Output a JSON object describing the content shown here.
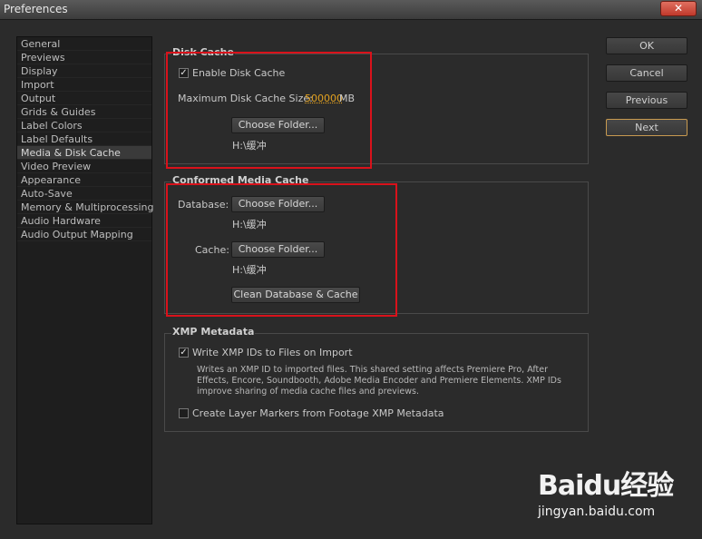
{
  "window": {
    "title": "Preferences",
    "close_label": "✕"
  },
  "sidebar": {
    "items": [
      {
        "label": "General"
      },
      {
        "label": "Previews"
      },
      {
        "label": "Display"
      },
      {
        "label": "Import"
      },
      {
        "label": "Output"
      },
      {
        "label": "Grids & Guides"
      },
      {
        "label": "Label Colors"
      },
      {
        "label": "Label Defaults"
      },
      {
        "label": "Media & Disk Cache",
        "selected": true
      },
      {
        "label": "Video Preview"
      },
      {
        "label": "Appearance"
      },
      {
        "label": "Auto-Save"
      },
      {
        "label": "Memory & Multiprocessing"
      },
      {
        "label": "Audio Hardware"
      },
      {
        "label": "Audio Output Mapping"
      }
    ]
  },
  "disk_cache": {
    "title": "Disk Cache",
    "enable_label": "Enable Disk Cache",
    "enable_checked": true,
    "max_size_label": "Maximum Disk Cache Size:",
    "max_size_value": "500000",
    "max_size_unit": "MB",
    "choose_folder_label": "Choose Folder...",
    "path": "H:\\缓冲"
  },
  "conformed_cache": {
    "title": "Conformed Media Cache",
    "database_label": "Database:",
    "database_button": "Choose Folder...",
    "database_path": "H:\\缓冲",
    "cache_label": "Cache:",
    "cache_button": "Choose Folder...",
    "cache_path": "H:\\缓冲",
    "clean_button": "Clean Database & Cache"
  },
  "xmp": {
    "title": "XMP Metadata",
    "write_ids_label": "Write XMP IDs to Files on Import",
    "write_ids_checked": true,
    "description": "Writes an XMP ID to imported files. This shared setting affects Premiere Pro, After Effects, Encore, Soundbooth, Adobe Media Encoder and Premiere Elements. XMP IDs improve sharing of media cache files and previews.",
    "layer_markers_label": "Create Layer Markers from Footage XMP Metadata",
    "layer_markers_checked": false
  },
  "buttons": {
    "ok": "OK",
    "cancel": "Cancel",
    "previous": "Previous",
    "next": "Next"
  },
  "watermark": {
    "logo": "Baidu经验",
    "url": "jingyan.baidu.com"
  },
  "colors": {
    "annotation": "#d9121b",
    "value_highlight": "#e0a020"
  }
}
